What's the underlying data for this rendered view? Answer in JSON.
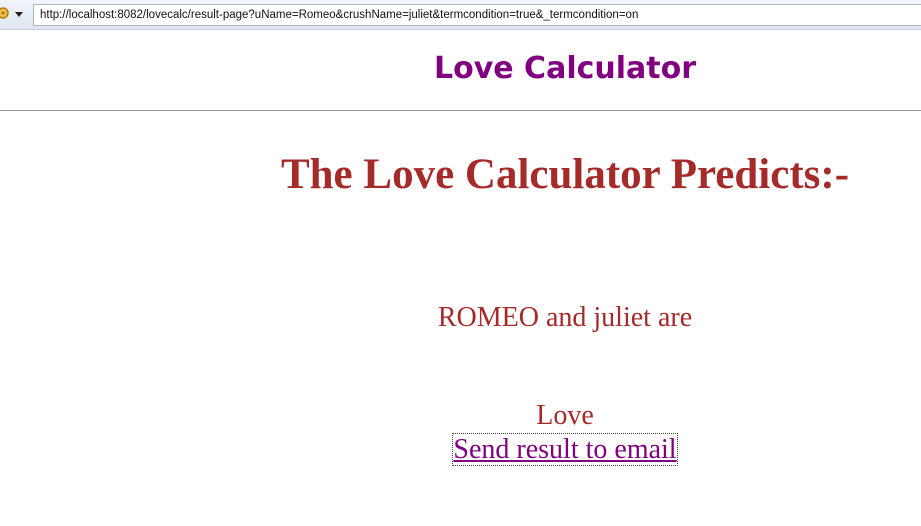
{
  "browser": {
    "url": "http://localhost:8082/lovecalc/result-page?uName=Romeo&crushName=juliet&termcondition=true&_termcondition=on"
  },
  "header": {
    "title": "Love Calculator"
  },
  "main": {
    "heading": "The Love Calculator Predicts:-",
    "result_line": "ROMEO and juliet are",
    "result_value": "Love",
    "email_link": "Send result to email"
  },
  "colors": {
    "header_title": "#800080",
    "body_text": "#a52a2a",
    "link": "#800080"
  }
}
